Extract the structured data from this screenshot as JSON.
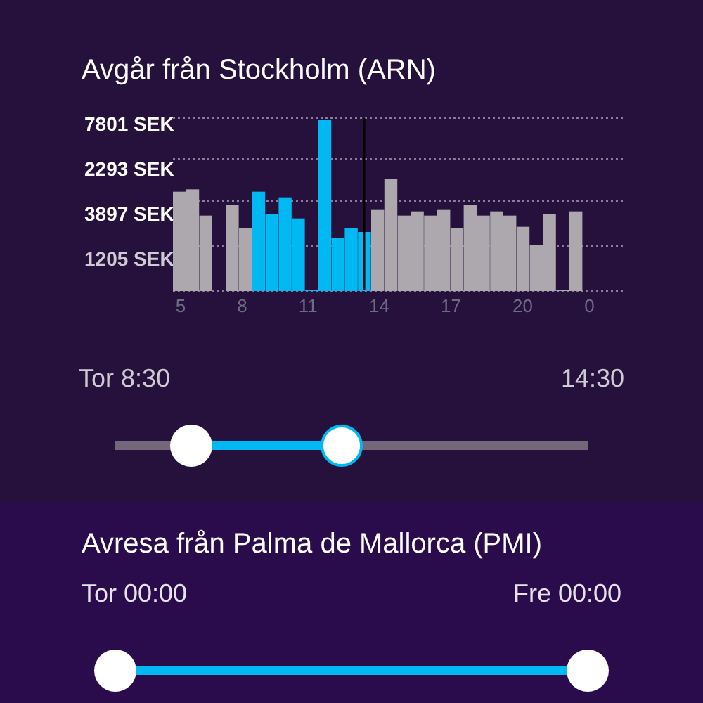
{
  "departure": {
    "title": "Avgår från Stockholm (ARN)",
    "price_labels": [
      "7801 SEK",
      "2293 SEK",
      "3897 SEK",
      "1205 SEK"
    ],
    "hour_labels": [
      "5",
      "8",
      "11",
      "14",
      "17",
      "20",
      "0"
    ],
    "start_label": "Tor 8:30",
    "end_label": "14:30",
    "range": {
      "low": {
        "level": 0.16
      },
      "high": {
        "level": 0.48
      }
    }
  },
  "return": {
    "title": "Avresa från Palma de Mallorca (PMI)",
    "start_label": "Tor 00:00",
    "end_label": "Fre 00:00",
    "range": {
      "low": {
        "level": 0
      },
      "high": {
        "level": 1
      }
    }
  }
}
